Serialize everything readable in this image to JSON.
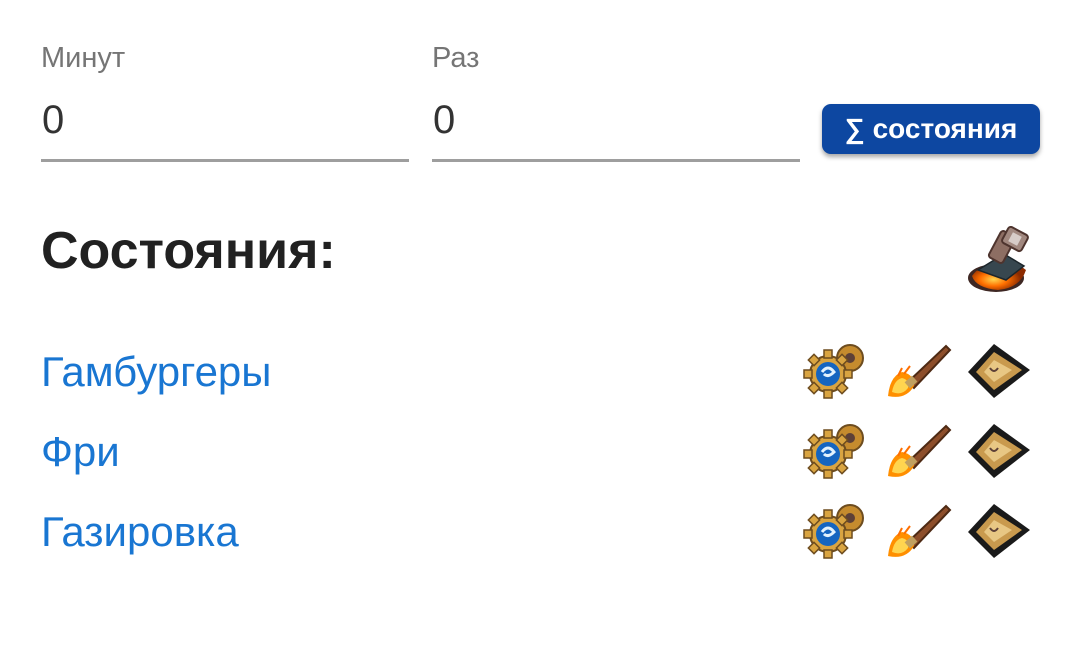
{
  "form": {
    "minutes": {
      "label": "Минут",
      "value": "0"
    },
    "times": {
      "label": "Раз",
      "value": "0"
    },
    "sum_button": {
      "sigma": "∑",
      "label": "состояния"
    }
  },
  "section": {
    "title": "Состояния:",
    "header_icon": "forge-hammer-icon"
  },
  "states": [
    {
      "label": "Гамбургеры",
      "icons": [
        "gear-icon",
        "torch-brush-icon",
        "arrowhead-icon"
      ]
    },
    {
      "label": "Фри",
      "icons": [
        "gear-icon",
        "torch-brush-icon",
        "arrowhead-icon"
      ]
    },
    {
      "label": "Газировка",
      "icons": [
        "gear-icon",
        "torch-brush-icon",
        "arrowhead-icon"
      ]
    }
  ],
  "colors": {
    "accent": "#0d47a1",
    "link": "#1976d2",
    "label": "#757575",
    "underline": "#9e9e9e"
  }
}
